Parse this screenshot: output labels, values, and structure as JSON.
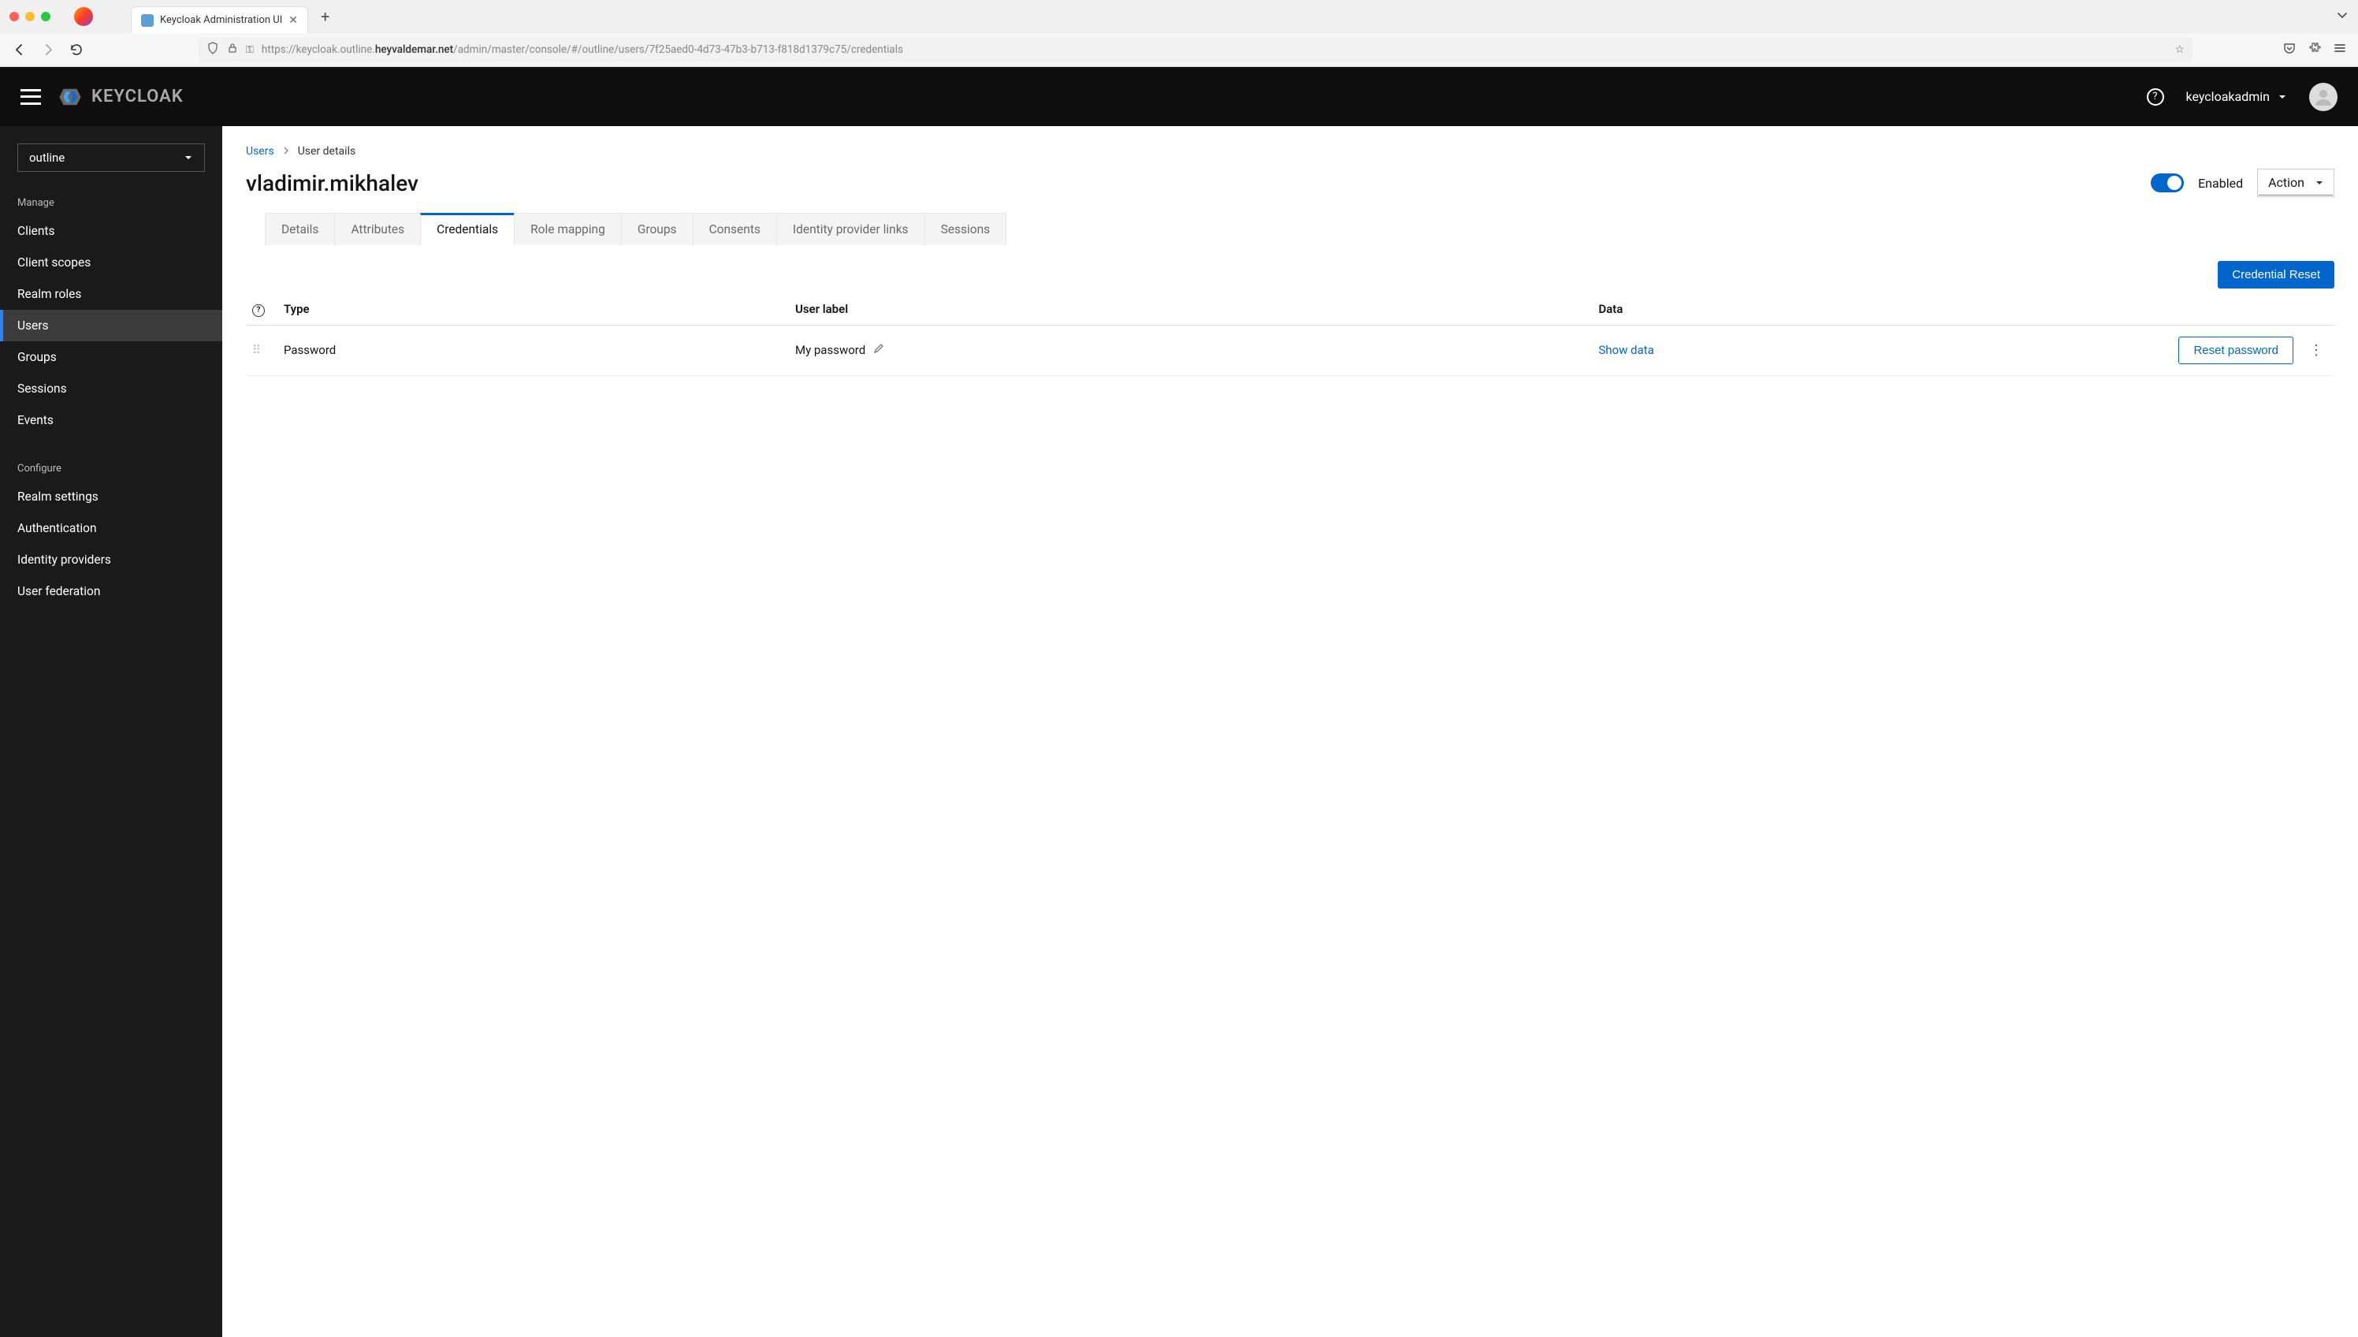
{
  "browser": {
    "tab_title": "Keycloak Administration UI",
    "url_prefix": "https://keycloak.outline.",
    "url_host": "heyvaldemar.net",
    "url_suffix": "/admin/master/console/#/outline/users/7f25aed0-4d73-47b3-b713-f818d1379c75/credentials"
  },
  "header": {
    "brand": "KEYCLOAK",
    "username": "keycloakadmin"
  },
  "sidebar": {
    "realm": "outline",
    "section_manage": "Manage",
    "section_configure": "Configure",
    "manage_items": [
      "Clients",
      "Client scopes",
      "Realm roles",
      "Users",
      "Groups",
      "Sessions",
      "Events"
    ],
    "configure_items": [
      "Realm settings",
      "Authentication",
      "Identity providers",
      "User federation"
    ],
    "active": "Users"
  },
  "breadcrumbs": {
    "root": "Users",
    "current": "User details"
  },
  "page": {
    "title": "vladimir.mikhalev",
    "enabled_label": "Enabled",
    "action_label": "Action"
  },
  "tabs": [
    "Details",
    "Attributes",
    "Credentials",
    "Role mapping",
    "Groups",
    "Consents",
    "Identity provider links",
    "Sessions"
  ],
  "active_tab": "Credentials",
  "toolbar": {
    "credential_reset": "Credential Reset"
  },
  "table": {
    "headers": {
      "type": "Type",
      "label": "User label",
      "data": "Data"
    },
    "rows": [
      {
        "type": "Password",
        "label": "My password",
        "show": "Show data",
        "reset": "Reset password"
      }
    ]
  }
}
